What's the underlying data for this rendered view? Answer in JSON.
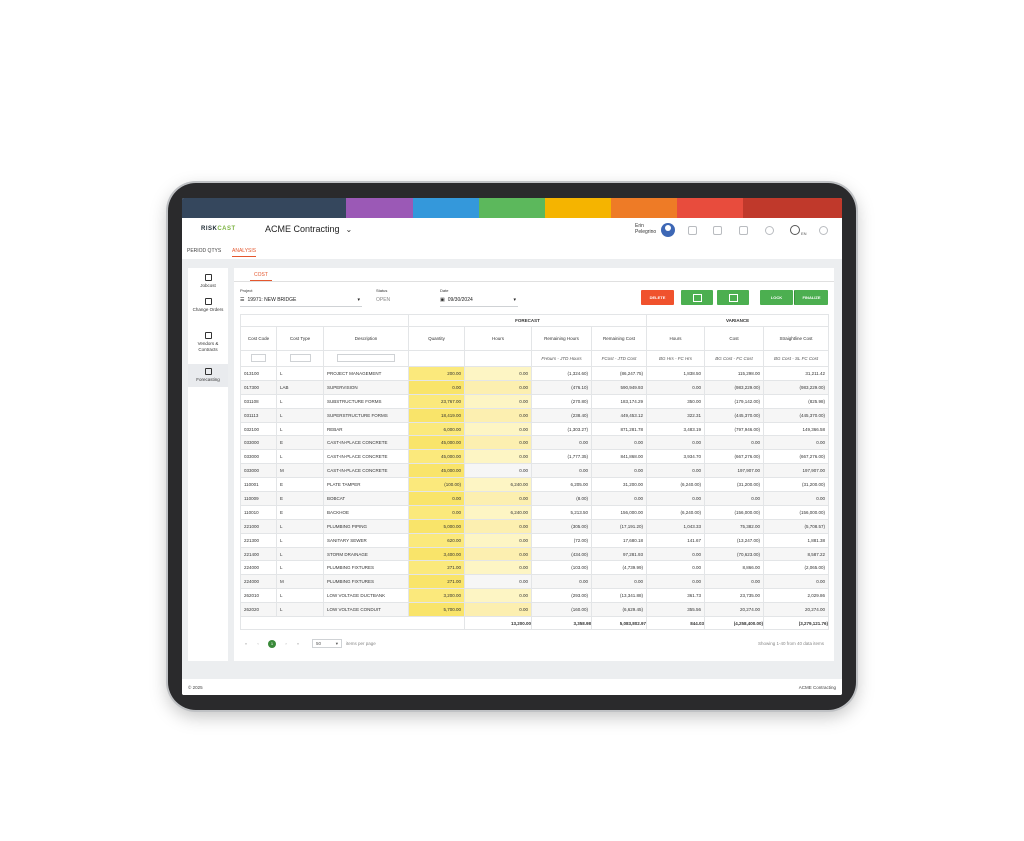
{
  "header": {
    "brand_colors": [
      "#35475d",
      "#9b59b6",
      "#3498db",
      "#5cb85c",
      "#f5b400",
      "#ee7b26",
      "#e84c3d",
      "#c0392b"
    ],
    "logo_main": "RISK",
    "logo_accent": "CAST",
    "company": "ACME Contracting",
    "user_first": "Erin",
    "user_last": "Pelegrino",
    "lang": "EN"
  },
  "tabs": [
    "PERIOD QTYS",
    "ANALYSIS"
  ],
  "sidebar": [
    "Jobcost",
    "Change Orders",
    "Vendors & Contracts",
    "Forecasting"
  ],
  "subtab": "COST",
  "filters": {
    "project_label": "Project",
    "project_value": "19971: NEW BRIDGE",
    "status_label": "Status",
    "status_value": "OPEN",
    "date_label": "Date",
    "date_value": "09/30/2024"
  },
  "buttons": {
    "delete": "DELETE",
    "lock": "LOCK",
    "finalize": "FINALIZE"
  },
  "table": {
    "group_forecast": "FORECAST",
    "group_variance": "VARIANCE",
    "headers": [
      "Cost Code",
      "Cost Type",
      "Description",
      "Quantity",
      "Hours",
      "Remaining Hours",
      "Remaining Cost",
      "Hours",
      "Cost",
      "Straightline Cost"
    ],
    "subheaders": [
      "FHours - JTD Hours",
      "FCost - JTD Cost",
      "BG Hrs - FC Hrs",
      "BG Cost - FC Cost",
      "BG Cost - SL FC Cost"
    ],
    "rows": [
      [
        "013100",
        "L",
        "PROJECT MANAGEMENT",
        "200.00",
        "0.00",
        "(1,324.60)",
        "(86,247.75)",
        "1,838.50",
        "115,298.00",
        "31,211.42"
      ],
      [
        "017300",
        "LAB",
        "SUPERVISION",
        "0.00",
        "0.00",
        "(476.10)",
        "590,949.93",
        "0.00",
        "(983,229.00)",
        "(983,229.00)"
      ],
      [
        "031108",
        "L",
        "SUBSTRUCTURE FORMS",
        "23,767.00",
        "0.00",
        "(270.80)",
        "183,174.29",
        "350.00",
        "(179,142.00)",
        "(825.98)"
      ],
      [
        "031113",
        "L",
        "SUPERSTRUCTURE FORMS",
        "18,419.00",
        "0.00",
        "(238.40)",
        "449,453.12",
        "322.31",
        "(445,370.00)",
        "(445,370.00)"
      ],
      [
        "032100",
        "L",
        "REBAR",
        "6,000.00",
        "0.00",
        "(1,303.27)",
        "871,281.78",
        "3,483.19",
        "(797,946.00)",
        "149,366.58"
      ],
      [
        "033000",
        "E",
        "CAST-IN-PLACE CONCRETE",
        "45,000.00",
        "0.00",
        "0.00",
        "0.00",
        "0.00",
        "0.00",
        "0.00"
      ],
      [
        "033000",
        "L",
        "CAST-IN-PLACE CONCRETE",
        "45,000.00",
        "0.00",
        "(1,777.35)",
        "841,868.00",
        "3,934.70",
        "(667,276.00)",
        "(667,276.00)"
      ],
      [
        "033000",
        "M",
        "CAST-IN-PLACE CONCRETE",
        "45,000.00",
        "0.00",
        "0.00",
        "0.00",
        "0.00",
        "197,907.00",
        "197,907.00"
      ],
      [
        "110001",
        "E",
        "PLATE TAMPER",
        "(100.00)",
        "6,240.00",
        "6,205.00",
        "31,200.00",
        "(6,240.00)",
        "(31,200.00)",
        "(31,200.00)"
      ],
      [
        "110009",
        "E",
        "BOBCAT",
        "0.00",
        "0.00",
        "(8.00)",
        "0.00",
        "0.00",
        "0.00",
        "0.00"
      ],
      [
        "110010",
        "E",
        "BACKHOE",
        "0.00",
        "6,240.00",
        "5,213.50",
        "156,000.00",
        "(6,240.00)",
        "(156,000.00)",
        "(156,000.00)"
      ],
      [
        "221000",
        "L",
        "PLUMBING PIPING",
        "5,000.00",
        "0.00",
        "(305.00)",
        "(17,191.20)",
        "1,043.33",
        "75,382.00",
        "(5,708.57)"
      ],
      [
        "221300",
        "L",
        "SANITARY SEWER",
        "620.00",
        "0.00",
        "(72.00)",
        "17,680.18",
        "141.67",
        "(13,247.00)",
        "1,881.38"
      ],
      [
        "221400",
        "L",
        "STORM DRAINAGE",
        "3,400.00",
        "0.00",
        "(434.00)",
        "97,281.93",
        "0.00",
        "(70,623.00)",
        "8,587.22"
      ],
      [
        "224000",
        "L",
        "PLUMBING FIXTURES",
        "271.00",
        "0.00",
        "(103.00)",
        "(4,739.99)",
        "0.00",
        "8,866.00",
        "(2,065.00)"
      ],
      [
        "224000",
        "M",
        "PLUMBING FIXTURES",
        "271.00",
        "0.00",
        "0.00",
        "0.00",
        "0.00",
        "0.00",
        "0.00"
      ],
      [
        "262010",
        "L",
        "LOW VOLTAGE DUCTBANK",
        "3,200.00",
        "0.00",
        "(293.00)",
        "(13,341.88)",
        "361.73",
        "23,735.00",
        "2,029.86"
      ],
      [
        "262020",
        "L",
        "LOW VOLTAGE CONDUIT",
        "5,700.00",
        "0.00",
        "(160.00)",
        "(6,629.45)",
        "355.56",
        "20,274.00",
        "20,274.00"
      ]
    ],
    "totals": [
      "13,200.00",
      "3,358.98",
      "5,083,802.97",
      "844.03",
      "(4,258,400.00)",
      "(3,279,121.76)"
    ]
  },
  "pager": {
    "first": "«",
    "prev": "‹",
    "current": "1",
    "next": "›",
    "last": "»",
    "per_page": "50",
    "per_page_label": "items per page",
    "summary": "Showing 1-40 from 40 data items"
  },
  "footer": {
    "copyright": "© 2025",
    "company": "ACME Contracting"
  }
}
